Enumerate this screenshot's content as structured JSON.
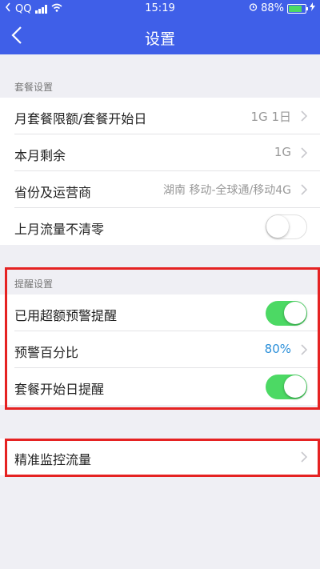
{
  "status": {
    "carrier": "QQ",
    "time": "15:19",
    "battery": "88%",
    "battery_level": 0.88
  },
  "nav": {
    "title": "设置"
  },
  "plan_section": {
    "header": "套餐设置",
    "rows": [
      {
        "label": "月套餐限额/套餐开始日",
        "value": "1G 1日"
      },
      {
        "label": "本月剩余",
        "value": "1G"
      },
      {
        "label": "省份及运营商",
        "value": "湖南 移动-全球通/移动4G"
      },
      {
        "label": "上月流量不清零",
        "toggle": false
      }
    ]
  },
  "reminder_section": {
    "header": "提醒设置",
    "rows": [
      {
        "label": "已用超额预警提醒",
        "toggle": true
      },
      {
        "label": "预警百分比",
        "value": "80%"
      },
      {
        "label": "套餐开始日提醒",
        "toggle": true
      }
    ]
  },
  "monitor_section": {
    "rows": [
      {
        "label": "精准监控流量"
      }
    ]
  },
  "colors": {
    "nav": "#3f5fe8",
    "toggle_on": "#4cd964",
    "highlight": "#e52222",
    "accent_value": "#2b8fd9"
  }
}
